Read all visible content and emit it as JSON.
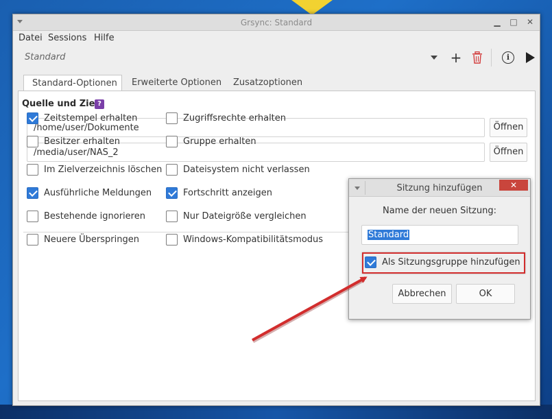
{
  "window": {
    "title": "Grsync: Standard",
    "minimize_glyph": "▁",
    "maximize_glyph": "□",
    "close_glyph": "✕"
  },
  "menu": [
    "Datei",
    "Sessions",
    "Hilfe"
  ],
  "toolbar": {
    "session_name": "Standard",
    "icons": [
      "chevron-down-icon",
      "plus-icon",
      "trash-icon",
      "info-icon",
      "play-icon"
    ],
    "info_glyph": "i",
    "plus_glyph": "+"
  },
  "tabs": [
    "Standard-Optionen",
    "Erweiterte Optionen",
    "Zusatzoptionen"
  ],
  "source": {
    "label": "Quelle und Ziel:",
    "help_glyph": "?",
    "source_path": "/home/user/Dokumente",
    "dest_path": "/media/user/NAS_2",
    "open_label": "Öffnen"
  },
  "options": [
    {
      "label": "Zeitstempel erhalten",
      "checked": true
    },
    {
      "label": "Zugriffsrechte erhalten",
      "checked": false
    },
    {
      "label": "Besitzer erhalten",
      "checked": false
    },
    {
      "label": "Gruppe erhalten",
      "checked": false
    },
    {
      "label": "Im Zielverzeichnis löschen",
      "checked": false
    },
    {
      "label": "Dateisystem nicht verlassen",
      "checked": false
    },
    {
      "label": "Ausführliche Meldungen",
      "checked": true
    },
    {
      "label": "Fortschritt anzeigen",
      "checked": true
    },
    {
      "label": "Bestehende ignorieren",
      "checked": false
    },
    {
      "label": "Nur Dateigröße vergleichen",
      "checked": false
    },
    {
      "label": "Neuere Überspringen",
      "checked": false
    },
    {
      "label": "Windows-Kompatibilitätsmodus",
      "checked": false
    }
  ],
  "dialog": {
    "title": "Sitzung hinzufügen",
    "close_glyph": "✕",
    "prompt": "Name der neuen Sitzung:",
    "input_value": "Standard",
    "group_checkbox_label": "Als Sitzungsgruppe hinzufügen",
    "group_checked": true,
    "cancel_label": "Abbrechen",
    "ok_label": "OK"
  },
  "colors": {
    "accent": "#2f7ad8",
    "annotation_red": "#d22d2d",
    "trash_red": "#d23b3b"
  }
}
